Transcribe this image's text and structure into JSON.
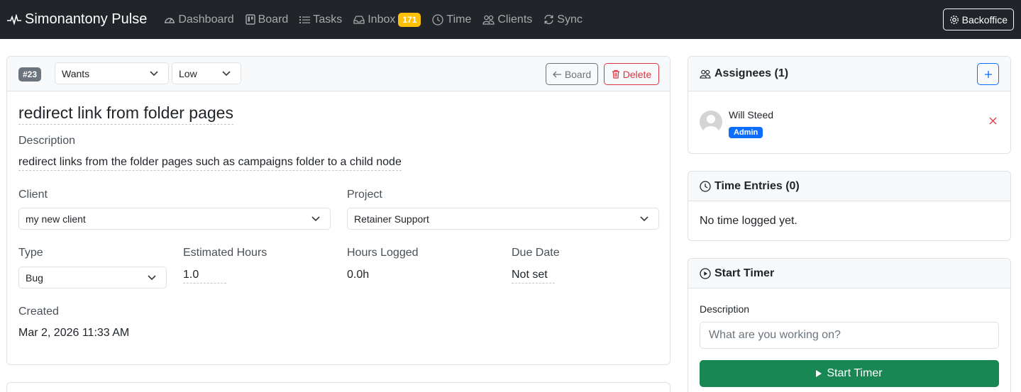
{
  "nav": {
    "brand": "Simonantony Pulse",
    "items": [
      {
        "label": "Dashboard",
        "icon": "speedometer-icon"
      },
      {
        "label": "Board",
        "icon": "kanban-icon"
      },
      {
        "label": "Tasks",
        "icon": "list-icon"
      },
      {
        "label": "Inbox",
        "icon": "inbox-icon",
        "badge": "171"
      },
      {
        "label": "Time",
        "icon": "clock-icon"
      },
      {
        "label": "Clients",
        "icon": "people-icon"
      },
      {
        "label": "Sync",
        "icon": "sync-icon"
      }
    ],
    "backoffice": "Backoffice"
  },
  "task": {
    "id": "#23",
    "status": "Wants",
    "priority": "Low",
    "board_label": "Board",
    "delete_label": "Delete",
    "title": "redirect link from folder pages",
    "description_label": "Description",
    "description": "redirect links from the folder pages such as campaigns folder to a child node",
    "client_label": "Client",
    "client": "my new client",
    "project_label": "Project",
    "project": "Retainer Support",
    "type_label": "Type",
    "type": "Bug",
    "estimated_label": "Estimated Hours",
    "estimated": "1.0",
    "logged_label": "Hours Logged",
    "logged": "0.0h",
    "due_label": "Due Date",
    "due": "Not set",
    "created_label": "Created",
    "created": "Mar 2, 2026 11:33 AM"
  },
  "assignees": {
    "title": "Assignees (1)",
    "list": [
      {
        "name": "Will Steed",
        "role": "Admin"
      }
    ]
  },
  "time_entries": {
    "title": "Time Entries (0)",
    "empty": "No time logged yet."
  },
  "timer": {
    "title": "Start Timer",
    "description_label": "Description",
    "placeholder": "What are you working on?",
    "button": "Start Timer"
  },
  "colors": {
    "navbar": "#212529",
    "inbox_badge": "#ffc107",
    "primary": "#0d6efd",
    "danger": "#dc3545",
    "success": "#198754",
    "secondary": "#6c757d"
  }
}
